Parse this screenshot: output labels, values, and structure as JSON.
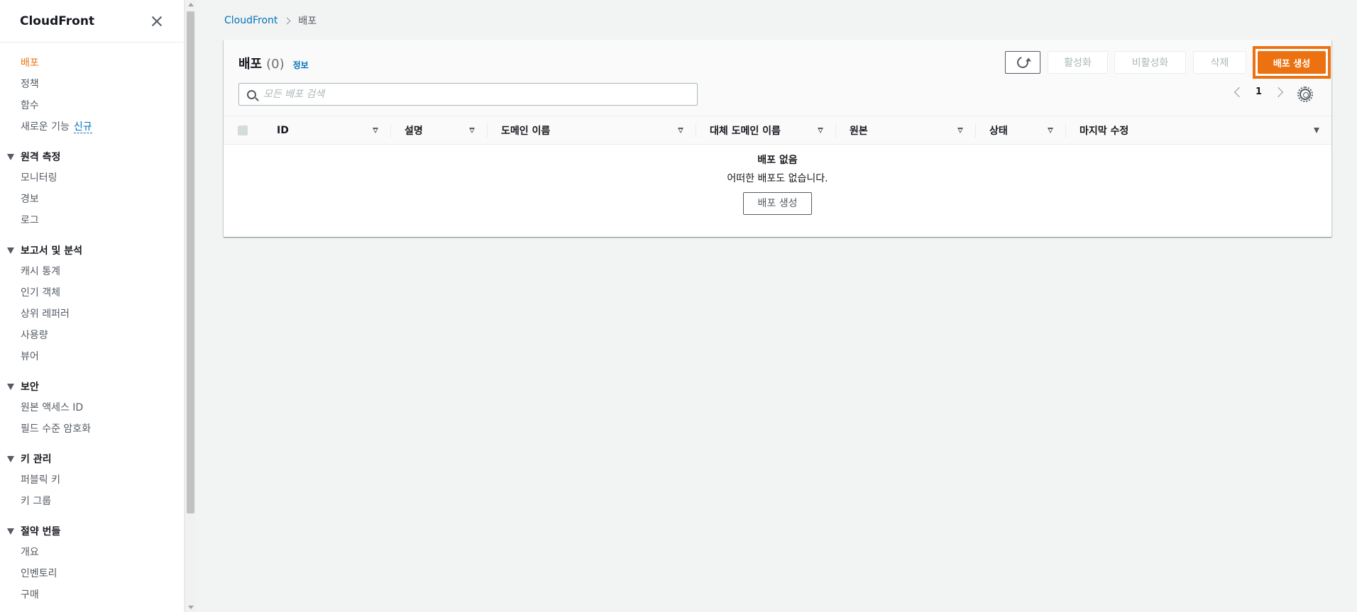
{
  "sidebar": {
    "title": "CloudFront",
    "items": [
      {
        "label": "배포",
        "active": true
      },
      {
        "label": "정책"
      },
      {
        "label": "함수"
      },
      {
        "label": "새로운 기능",
        "badge": "신규"
      }
    ],
    "sections": [
      {
        "title": "원격 측정",
        "items": [
          "모니터링",
          "경보",
          "로그"
        ]
      },
      {
        "title": "보고서 및 분석",
        "items": [
          "캐시 통계",
          "인기 객체",
          "상위 레퍼러",
          "사용량",
          "뷰어"
        ]
      },
      {
        "title": "보안",
        "items": [
          "원본 액세스 ID",
          "필드 수준 암호화"
        ]
      },
      {
        "title": "키 관리",
        "items": [
          "퍼블릭 키",
          "키 그룹"
        ]
      },
      {
        "title": "절약 번들",
        "items": [
          "개요",
          "인벤토리",
          "구매"
        ]
      }
    ]
  },
  "breadcrumb": {
    "root": "CloudFront",
    "current": "배포"
  },
  "panel": {
    "title": "배포",
    "count": "(0)",
    "info": "정보",
    "buttons": {
      "activate": "활성화",
      "deactivate": "비활성화",
      "delete": "삭제",
      "create": "배포 생성"
    },
    "search_placeholder": "모든 배포 검색",
    "page": "1"
  },
  "table": {
    "columns": [
      "ID",
      "설명",
      "도메인 이름",
      "대체 도메인 이름",
      "원본",
      "상태",
      "마지막 수정"
    ]
  },
  "empty_state": {
    "title": "배포 없음",
    "description": "어떠한 배포도 없습니다.",
    "button": "배포 생성"
  },
  "colors": {
    "accent": "#ec7211",
    "link": "#0073bb"
  }
}
